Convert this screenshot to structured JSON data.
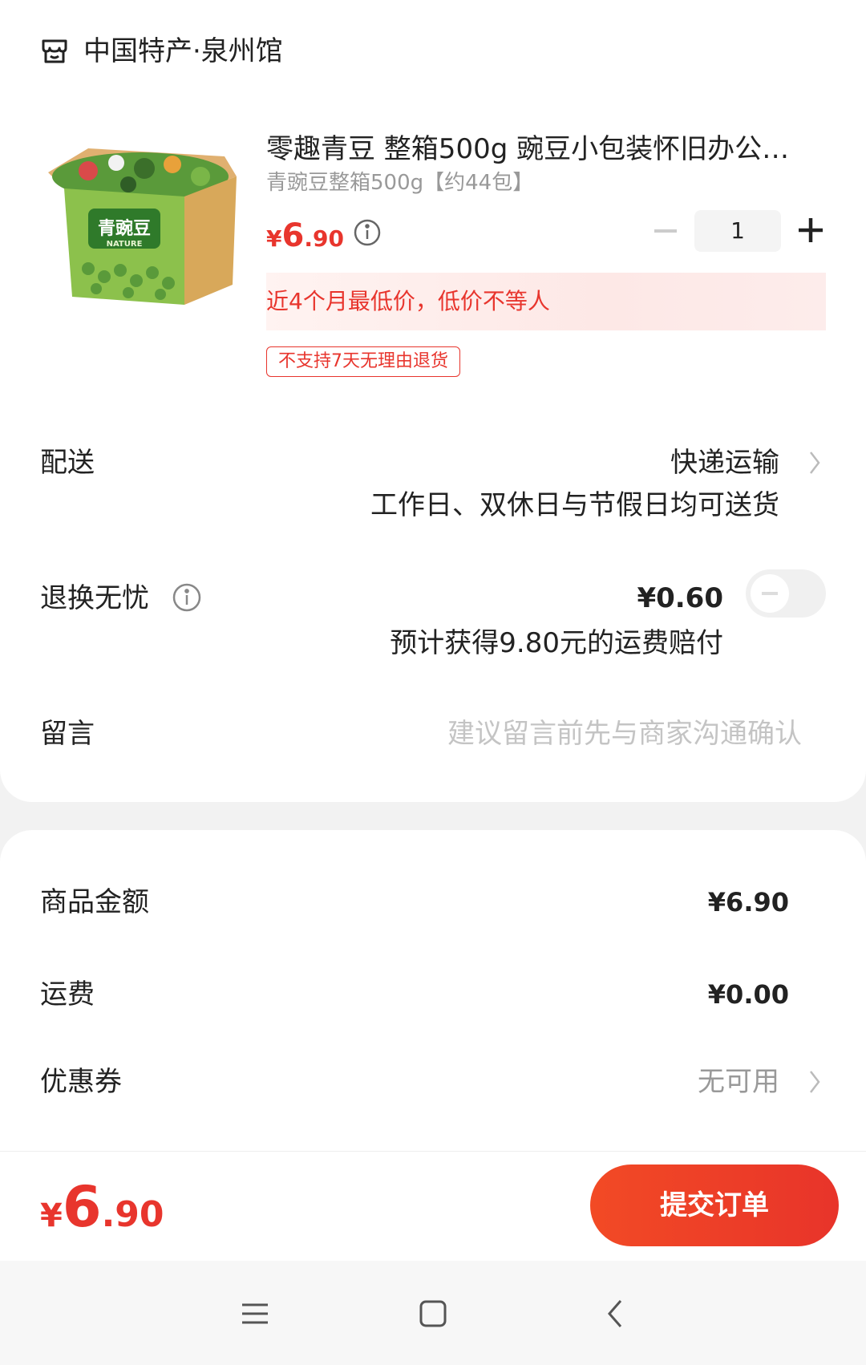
{
  "shop": {
    "name": "中国特产·泉州馆",
    "icon": "shop-icon"
  },
  "product": {
    "title": "零趣青豆 整箱500g 豌豆小包装怀旧办公…",
    "spec": "青豌豆整箱500g【约44包】",
    "price": {
      "symbol": "¥",
      "integer": "6",
      "decimal": ".90"
    },
    "quantity": "1",
    "low_price_banner": "近4个月最低价，低价不等人",
    "return_tag": "不支持7天无理由退货",
    "image_box_text": "青豌豆",
    "image_box_subtext": "NATURE"
  },
  "delivery": {
    "label": "配送",
    "value": "快递运输",
    "note": "工作日、双休日与节假日均可送货"
  },
  "return_insurance": {
    "label": "退换无忧",
    "price": "¥0.60",
    "note": "预计获得9.80元的运费赔付",
    "enabled": false
  },
  "message": {
    "label": "留言",
    "value": "",
    "placeholder": "建议留言前先与商家沟通确认"
  },
  "summary": {
    "goods_label": "商品金额",
    "goods_value": "¥6.90",
    "shipping_label": "运费",
    "shipping_value": "¥0.00",
    "coupon_label": "优惠券",
    "coupon_value": "无可用"
  },
  "footer": {
    "total": {
      "symbol": "¥",
      "integer": "6",
      "decimal": ".90"
    },
    "submit_label": "提交订单"
  },
  "colors": {
    "accent": "#e8352d",
    "muted": "#999999",
    "placeholder": "#c4c4c4"
  }
}
